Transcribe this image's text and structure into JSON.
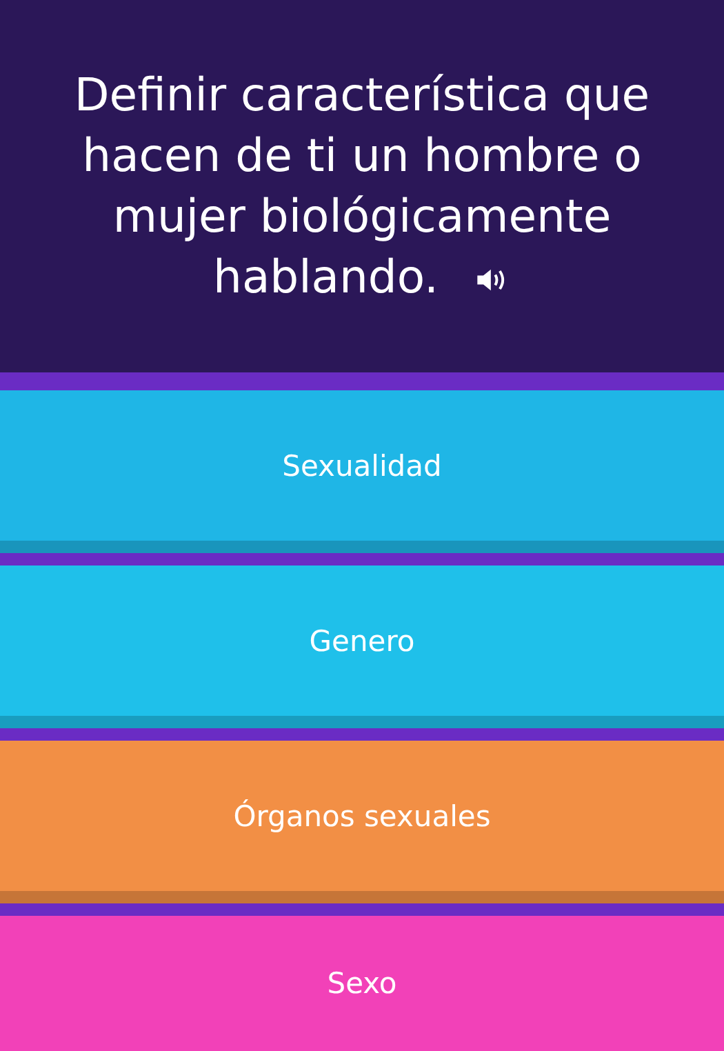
{
  "question": {
    "text": "Definir característica que hacen de ti un hombre o mujer biológicamente hablando."
  },
  "options": [
    {
      "label": "Sexualidad",
      "color": "#1fb6e6"
    },
    {
      "label": "Genero",
      "color": "#1fc0ea"
    },
    {
      "label": "Órganos sexuales",
      "color": "#f28f45"
    },
    {
      "label": "Sexo",
      "color": "#f241b8"
    }
  ]
}
